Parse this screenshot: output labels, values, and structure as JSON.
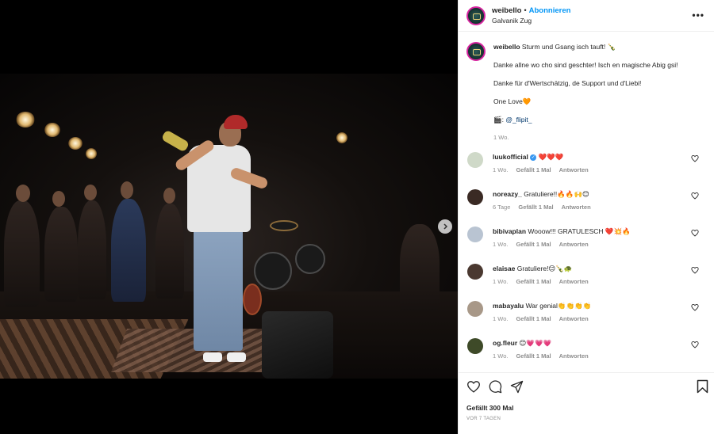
{
  "post": {
    "username": "weibello",
    "follow_label": "Abonnieren",
    "location": "Galvanik Zug",
    "caption": {
      "username": "weibello",
      "line1": "Sturm und Gsang isch tauft! 🍾",
      "line2": "Danke allne wo cho sind geschter! Isch en magische Abig gsi!",
      "line3": "Danke für d'Wertschätzig, de Support und d'Liebi!",
      "line4": "One Love🧡",
      "credit_prefix": "🎬: ",
      "credit_link": "@_flipit_",
      "time": "1 Wo."
    },
    "comments": [
      {
        "user": "luukofficial",
        "verified": true,
        "text": "❤️❤️❤️",
        "time": "1 Wo.",
        "likes": "Gefällt 1 Mal",
        "reply": "Antworten",
        "avatar_color": "#cfd9c8"
      },
      {
        "user": "noreazy_",
        "verified": false,
        "text": "Gratuliere!!🔥🔥🙌😊",
        "time": "6 Tage",
        "likes": "Gefällt 1 Mal",
        "reply": "Antworten",
        "avatar_color": "#3a2a24"
      },
      {
        "user": "bibivaplan",
        "verified": false,
        "text": "Wooow!!! GRATULESCH ❤️💥🔥",
        "time": "1 Wo.",
        "likes": "Gefällt 1 Mal",
        "reply": "Antworten",
        "avatar_color": "#b9c4d2"
      },
      {
        "user": "elaisae",
        "verified": false,
        "text": "Gratuliere!😊🍾🐢",
        "time": "1 Wo.",
        "likes": "Gefällt 1 Mal",
        "reply": "Antworten",
        "avatar_color": "#4a3830"
      },
      {
        "user": "mabayalu",
        "verified": false,
        "text": "War genial👏👏👏👏",
        "time": "1 Wo.",
        "likes": "Gefällt 1 Mal",
        "reply": "Antworten",
        "avatar_color": "#a89888"
      },
      {
        "user": "og.fleur",
        "verified": false,
        "text": "😊💗💗💗",
        "time": "1 Wo.",
        "likes": "Gefällt 1 Mal",
        "reply": "Antworten",
        "avatar_color": "#3e4a28"
      }
    ],
    "likes_text": "Gefällt 300 Mal",
    "posted_ago": "VOR 7 TAGEN",
    "more_icon": "more-options-icon",
    "icons": [
      "heart-icon",
      "comment-icon",
      "share-icon",
      "bookmark-icon",
      "chevron-right-icon"
    ]
  }
}
